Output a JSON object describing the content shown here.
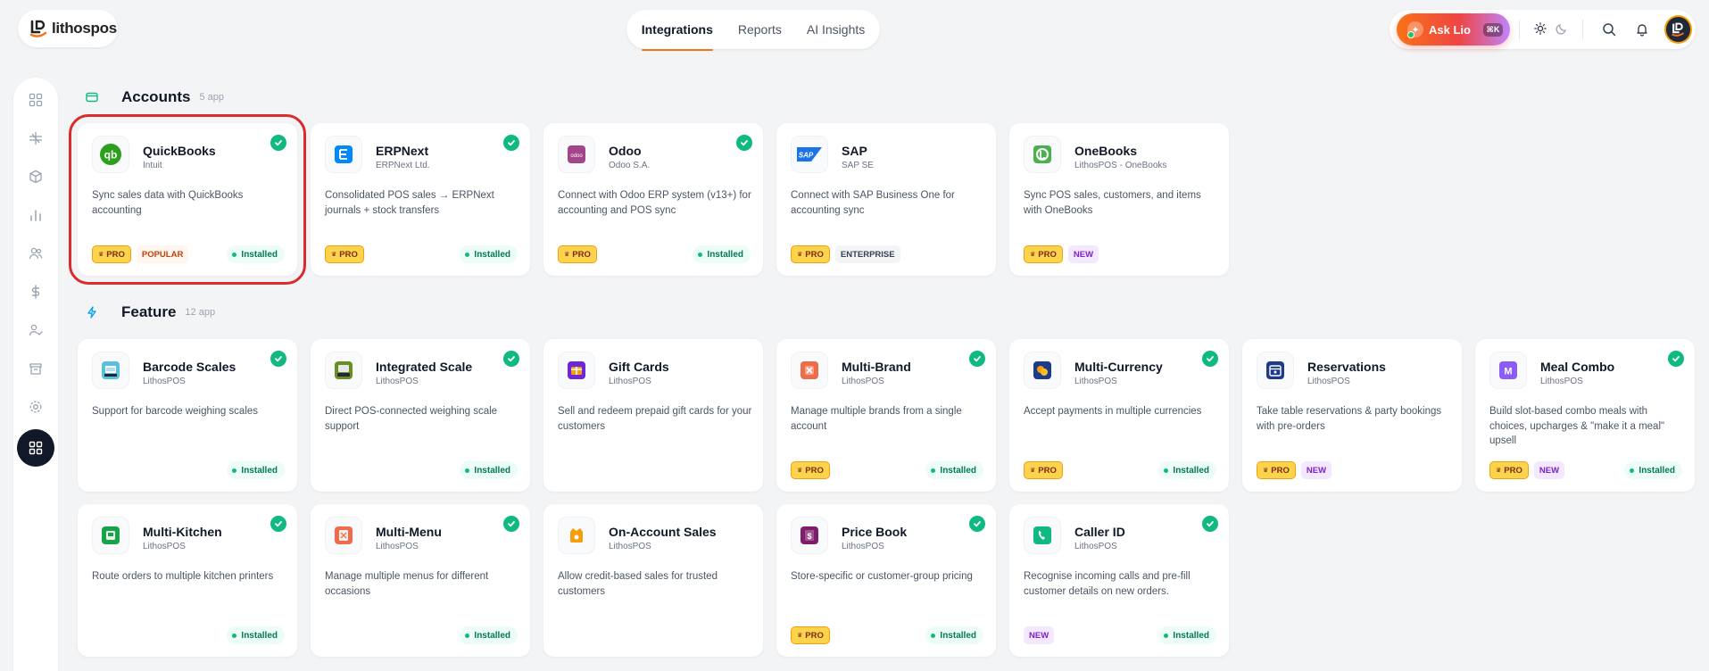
{
  "brand": {
    "name": "lithospos"
  },
  "nav": {
    "tabs": [
      "Integrations",
      "Reports",
      "AI Insights"
    ],
    "active": "Integrations"
  },
  "header": {
    "ask_label": "Ask Lio",
    "ask_shortcut": "⌘K"
  },
  "labels": {
    "installed": "Installed",
    "pro": "PRO"
  },
  "sections": [
    {
      "title": "Accounts",
      "count": "5 app",
      "cards": [
        {
          "name": "QuickBooks",
          "vendor": "Intuit",
          "desc": "Sync sales data with QuickBooks accounting",
          "badges": [
            "PRO",
            "POPULAR"
          ],
          "installed": true,
          "logo": "quickbooks-logo",
          "color": "#2ca01c"
        },
        {
          "name": "ERPNext",
          "vendor": "ERPNext Ltd.",
          "desc": "Consolidated POS sales → ERPNext journals + stock transfers",
          "badges": [
            "PRO"
          ],
          "installed": true,
          "logo": "erpnext-logo",
          "color": "#0089ff"
        },
        {
          "name": "Odoo",
          "vendor": "Odoo S.A.",
          "desc": "Connect with Odoo ERP system (v13+) for accounting and POS sync",
          "badges": [
            "PRO"
          ],
          "installed": true,
          "logo": "odoo-logo",
          "color": "#a24689"
        },
        {
          "name": "SAP",
          "vendor": "SAP SE",
          "desc": "Connect with SAP Business One for accounting sync",
          "badges": [
            "PRO",
            "ENTERPRISE"
          ],
          "installed": false,
          "logo": "sap-logo",
          "color": "#1a73e8"
        },
        {
          "name": "OneBooks",
          "vendor": "LithosPOS - OneBooks",
          "desc": "Sync POS sales, customers, and items with OneBooks",
          "badges": [
            "PRO",
            "NEW"
          ],
          "installed": false,
          "logo": "onebooks-logo",
          "color": "#4caf50"
        }
      ]
    },
    {
      "title": "Feature",
      "count": "12 app",
      "cards": [
        {
          "name": "Barcode Scales",
          "vendor": "LithosPOS",
          "desc": "Support for barcode weighing scales",
          "badges": [],
          "installed": true,
          "logo": "barcode-scale-icon",
          "color": "#5bc0de"
        },
        {
          "name": "Integrated Scale",
          "vendor": "LithosPOS",
          "desc": "Direct POS-connected weighing scale support",
          "badges": [],
          "installed": true,
          "logo": "scale-icon",
          "color": "#6b8e23"
        },
        {
          "name": "Gift Cards",
          "vendor": "LithosPOS",
          "desc": "Sell and redeem prepaid gift cards for your customers",
          "badges": [],
          "installed": false,
          "logo": "gift-card-icon",
          "color": "#6d28d9"
        },
        {
          "name": "Multi-Brand",
          "vendor": "LithosPOS",
          "desc": "Manage multiple brands from a single account",
          "badges": [
            "PRO"
          ],
          "installed": true,
          "logo": "multi-brand-icon",
          "color": "#ef6c4a"
        },
        {
          "name": "Multi-Currency",
          "vendor": "LithosPOS",
          "desc": "Accept payments in multiple currencies",
          "badges": [
            "PRO"
          ],
          "installed": true,
          "logo": "currency-icon",
          "color": "#1e3a8a"
        },
        {
          "name": "Reservations",
          "vendor": "LithosPOS",
          "desc": "Take table reservations & party bookings with pre-orders",
          "badges": [
            "PRO",
            "NEW"
          ],
          "installed": false,
          "logo": "calendar-icon",
          "color": "#1e3a8a"
        },
        {
          "name": "Meal Combo",
          "vendor": "LithosPOS",
          "desc": "Build slot-based combo meals with choices, upcharges & \"make it a meal\" upsell",
          "badges": [
            "PRO",
            "NEW"
          ],
          "installed": true,
          "logo": "meal-combo-icon",
          "color": "#8b5cf6"
        },
        {
          "name": "Multi-Kitchen",
          "vendor": "LithosPOS",
          "desc": "Route orders to multiple kitchen printers",
          "badges": [],
          "installed": true,
          "logo": "kitchen-icon",
          "color": "#16a34a"
        },
        {
          "name": "Multi-Menu",
          "vendor": "LithosPOS",
          "desc": "Manage multiple menus for different occasions",
          "badges": [],
          "installed": true,
          "logo": "menu-icon",
          "color": "#ef6c4a"
        },
        {
          "name": "On-Account Sales",
          "vendor": "LithosPOS",
          "desc": "Allow credit-based sales for trusted customers",
          "badges": [],
          "installed": false,
          "logo": "wallet-icon",
          "color": "#f59e0b"
        },
        {
          "name": "Price Book",
          "vendor": "LithosPOS",
          "desc": "Store-specific or customer-group pricing",
          "badges": [
            "PRO"
          ],
          "installed": true,
          "logo": "price-book-icon",
          "color": "#7e1d6b"
        },
        {
          "name": "Caller ID",
          "vendor": "LithosPOS",
          "desc": "Recognise incoming calls and pre-fill customer details on new orders.",
          "badges": [
            "NEW"
          ],
          "installed": true,
          "logo": "phone-icon",
          "color": "#10b981"
        }
      ]
    }
  ],
  "sidebar": {
    "items": [
      "dashboard-icon",
      "pos-icon",
      "inventory-icon",
      "reports-icon",
      "customers-icon",
      "finance-icon",
      "staff-icon",
      "store-icon",
      "settings-icon",
      "apps-icon"
    ]
  }
}
